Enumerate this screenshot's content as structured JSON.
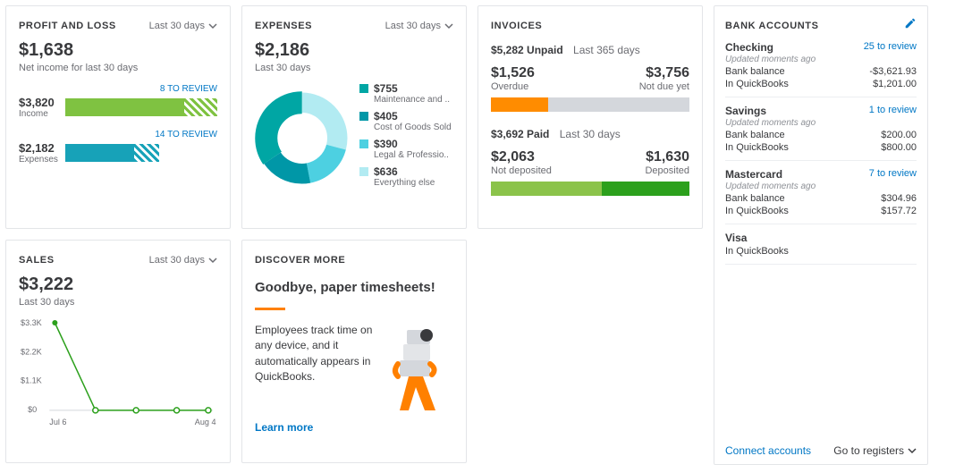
{
  "profit_loss": {
    "title": "PROFIT AND LOSS",
    "period": "Last 30 days",
    "net_income": "$1,638",
    "net_income_caption": "Net income for last 30 days",
    "income_amount": "$3,820",
    "income_caption": "Income",
    "income_review": "8 TO REVIEW",
    "expenses_amount": "$2,182",
    "expenses_caption": "Expenses",
    "expenses_review": "14 TO REVIEW"
  },
  "expenses": {
    "title": "EXPENSES",
    "period": "Last 30 days",
    "total": "$2,186",
    "total_caption": "Last 30 days",
    "legend": [
      {
        "amount": "$755",
        "label": "Maintenance and ..",
        "color": "#00a6a4"
      },
      {
        "amount": "$405",
        "label": "Cost of Goods Sold",
        "color": "#0097a7"
      },
      {
        "amount": "$390",
        "label": "Legal & Professio..",
        "color": "#4dd0e1"
      },
      {
        "amount": "$636",
        "label": "Everything else",
        "color": "#b2ebf2"
      }
    ]
  },
  "invoices": {
    "title": "INVOICES",
    "unpaid_total": "$5,282 Unpaid",
    "unpaid_period": "Last 365 days",
    "overdue_amt": "$1,526",
    "overdue_caption": "Overdue",
    "notdue_amt": "$3,756",
    "notdue_caption": "Not due yet",
    "paid_total": "$3,692 Paid",
    "paid_period": "Last 30 days",
    "notdep_amt": "$2,063",
    "notdep_caption": "Not deposited",
    "dep_amt": "$1,630",
    "dep_caption": "Deposited"
  },
  "bank": {
    "title": "BANK ACCOUNTS",
    "accounts": [
      {
        "name": "Checking",
        "link": "25 to review",
        "updated": "Updated moments ago",
        "bank_bal": "-$3,621.93",
        "qb_bal": "$1,201.00"
      },
      {
        "name": "Savings",
        "link": "1 to review",
        "updated": "Updated moments ago",
        "bank_bal": "$200.00",
        "qb_bal": "$800.00"
      },
      {
        "name": "Mastercard",
        "link": "7 to review",
        "updated": "Updated moments ago",
        "bank_bal": "$304.96",
        "qb_bal": "$157.72"
      },
      {
        "name": "Visa",
        "link": "",
        "updated": "",
        "bank_bal": "",
        "qb_bal": ""
      }
    ],
    "bank_bal_label": "Bank balance",
    "qb_bal_label": "In QuickBooks",
    "connect": "Connect accounts",
    "goto": "Go to registers"
  },
  "sales": {
    "title": "SALES",
    "period": "Last 30 days",
    "total": "$3,222",
    "total_caption": "Last 30 days"
  },
  "discover": {
    "title": "DISCOVER MORE",
    "heading": "Goodbye, paper timesheets!",
    "body": "Employees track time on any device, and it automatically appears in QuickBooks.",
    "learn": "Learn more"
  },
  "chart_data": [
    {
      "type": "bar",
      "card": "profit_loss",
      "series": [
        {
          "name": "Income",
          "values": [
            3820
          ],
          "color": "#7fc241",
          "review_pattern": true
        },
        {
          "name": "Expenses",
          "values": [
            2182
          ],
          "color": "#17a2b8",
          "review_pattern": true
        }
      ],
      "max": 3820
    },
    {
      "type": "pie",
      "card": "expenses",
      "categories": [
        "Maintenance and ..",
        "Cost of Goods Sold",
        "Legal & Professio..",
        "Everything else"
      ],
      "values": [
        755,
        405,
        390,
        636
      ],
      "colors": [
        "#00a6a4",
        "#0097a7",
        "#4dd0e1",
        "#b2ebf2"
      ],
      "total": 2186
    },
    {
      "type": "bar",
      "card": "invoices_unpaid",
      "categories": [
        "Overdue",
        "Not due yet"
      ],
      "values": [
        1526,
        3756
      ],
      "colors": [
        "#ff8c00",
        "#d4d7dc"
      ],
      "total": 5282
    },
    {
      "type": "bar",
      "card": "invoices_paid",
      "categories": [
        "Not deposited",
        "Deposited"
      ],
      "values": [
        2063,
        1630
      ],
      "colors": [
        "#8bc34a",
        "#2ca01c"
      ],
      "total": 3692
    },
    {
      "type": "line",
      "card": "sales",
      "x": [
        "Jul 6",
        "",
        "",
        "",
        "Aug 4"
      ],
      "values": [
        3300,
        0,
        0,
        0,
        0
      ],
      "y_ticks": [
        "$3.3K",
        "$2.2K",
        "$1.1K",
        "$0"
      ],
      "ylim": [
        0,
        3300
      ],
      "color": "#2ca01c"
    }
  ]
}
